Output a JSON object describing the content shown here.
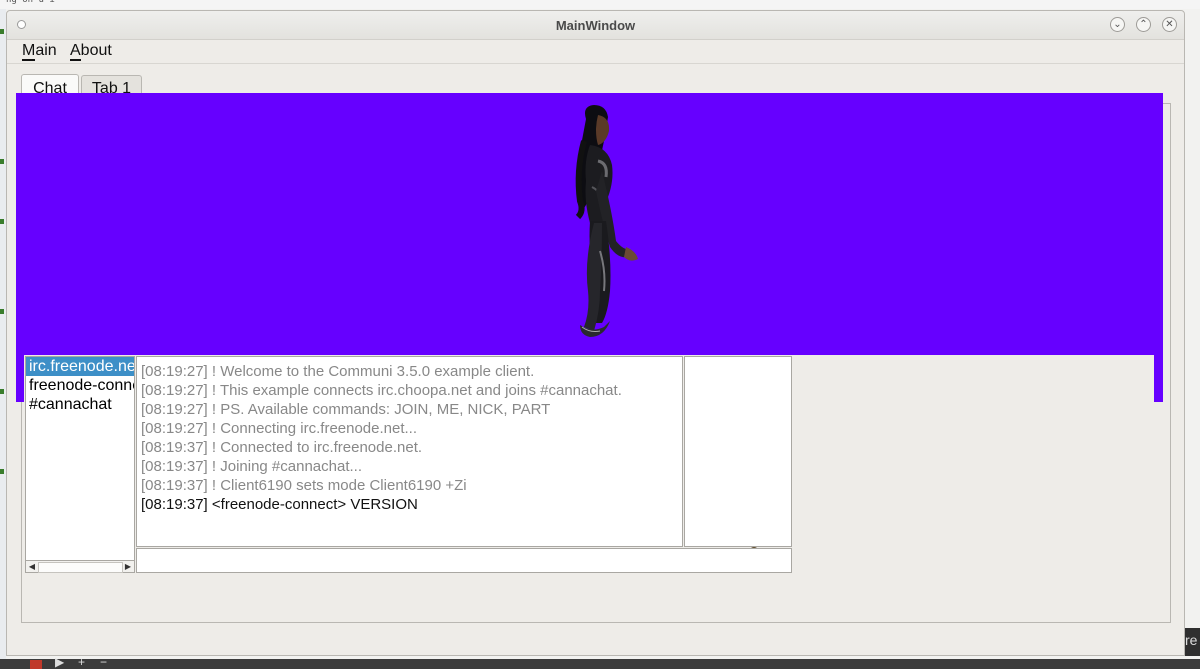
{
  "window": {
    "title": "MainWindow"
  },
  "menu": {
    "items": [
      "Main",
      "About"
    ]
  },
  "tabs": [
    {
      "label": "Chat",
      "active": true
    },
    {
      "label": "Tab 1",
      "active": false
    }
  ],
  "scene": {
    "background_color": "#6600ff"
  },
  "channels": {
    "items": [
      "irc.freenode.net",
      "freenode-connect",
      "#cannachat"
    ],
    "selected_index": 0
  },
  "log": {
    "lines": [
      {
        "text": "[08:19:27] ! Welcome to the Communi 3.5.0 example client.",
        "style": "info"
      },
      {
        "text": "[08:19:27] ! This example connects irc.choopa.net and joins #cannachat.",
        "style": "info"
      },
      {
        "text": "[08:19:27] ! PS. Available commands: JOIN, ME, NICK, PART",
        "style": "info"
      },
      {
        "text": "[08:19:27] ! Connecting irc.freenode.net...",
        "style": "info"
      },
      {
        "text": "[08:19:37] ! Connected to irc.freenode.net.",
        "style": "info"
      },
      {
        "text": "[08:19:37] ! Joining #cannachat...",
        "style": "info"
      },
      {
        "text": "[08:19:37] ! Client6190 sets mode Client6190 +Zi",
        "style": "info"
      },
      {
        "text": "[08:19:37] <freenode-connect> VERSION",
        "style": "message"
      }
    ]
  },
  "message_input": {
    "value": ""
  },
  "colors": {
    "selection": "#3d8fc7",
    "info_text": "#888888"
  }
}
